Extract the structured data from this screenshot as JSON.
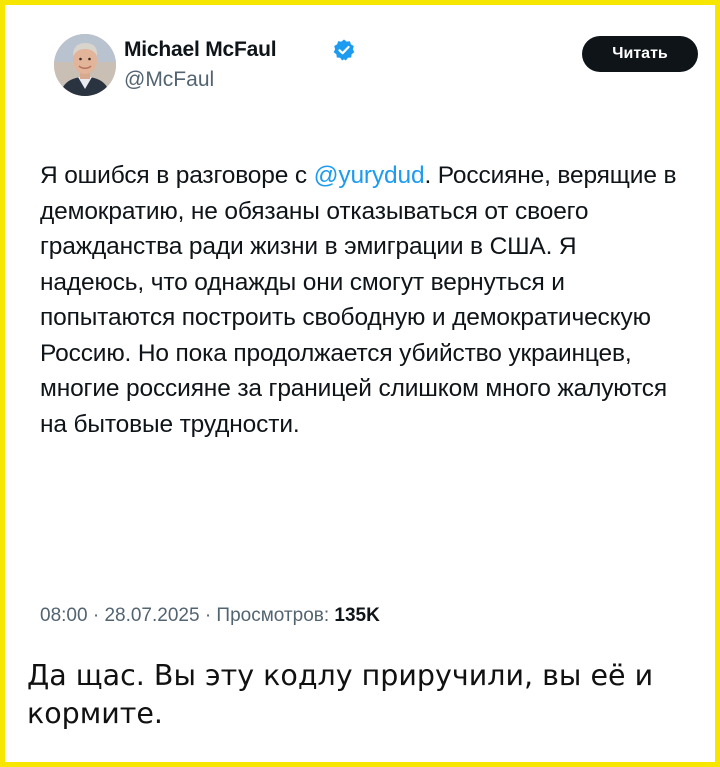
{
  "author": {
    "name": "Michael McFaul",
    "handle": "@McFaul",
    "verified_color": "#1d9bf0"
  },
  "actions": {
    "read_label": "Читать"
  },
  "tweet": {
    "text_before_mention": "Я ошибся в разговоре с ",
    "mention": "@yurydud",
    "text_after_mention": ". Россияне, верящие в демократию, не обязаны отказываться от своего гражданства ради жизни в эмиграции в США. Я надеюсь, что однажды они смогут вернуться и попытаются построить свободную и демократическую Россию. Но пока продолжается убийство украинцев, многие россияне за границей слишком много жалуются на бытовые трудности.",
    "time": "08:00",
    "date": "28.07.2025",
    "views_label": "Просмотров:",
    "views_count": "135K"
  },
  "caption": {
    "text": "Да щас. Вы эту кодлу приручили, вы её и кормите."
  },
  "colors": {
    "frame_border": "#f7e600",
    "mention": "#1d9bf0",
    "secondary_text": "#536471",
    "button_bg": "#0f1419"
  },
  "icons": {
    "verified": "verified-badge-icon",
    "avatar": "profile-photo"
  }
}
